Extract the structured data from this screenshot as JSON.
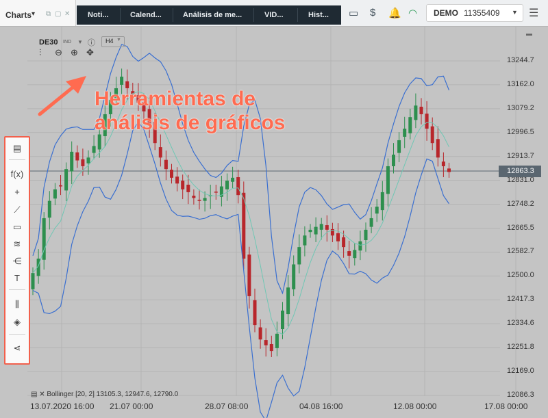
{
  "window": {
    "title": "Charts",
    "tabs": [
      "Noti...",
      "Calend...",
      "Análisis de me...",
      "VID...",
      "Hist..."
    ]
  },
  "account": {
    "mode": "DEMO",
    "number": "11355409"
  },
  "chart_header": {
    "symbol": "DE30",
    "instrument_tag": "IND",
    "timeframe": "H4"
  },
  "annotation": {
    "line1": "Herramientas de",
    "line2": "análisis de gráficos",
    "color": "#ff6b50"
  },
  "toolbar_icons": [
    "chart-type-icon",
    "function-icon",
    "crosshair-icon",
    "trend-line-icon",
    "rectangle-icon",
    "fibonacci-icon",
    "pitchfork-icon",
    "text-icon",
    "indicators-icon",
    "layers-icon",
    "share-icon"
  ],
  "legend": {
    "text": "Bollinger [20, 2] 13105.3, 12947.6, 12790.0"
  },
  "chart_data": {
    "type": "candlestick",
    "y_ticks": [
      "13244.7",
      "13162.0",
      "13079.2",
      "12996.5",
      "12913.7",
      "12831.0",
      "12748.2",
      "12665.5",
      "12582.7",
      "12500.0",
      "12417.3",
      "12334.6",
      "12251.8",
      "12169.0",
      "12086.3"
    ],
    "x_ticks": [
      "13.07.2020 16:00",
      "21.07 00:00",
      "28.07 08:00",
      "04.08 16:00",
      "12.08 00:00",
      "17.08 00:00"
    ],
    "last_price": "12863.3",
    "ylim": [
      12086.3,
      13244.7
    ],
    "series": [
      {
        "name": "Bollinger upper",
        "color": "#3a6fd0"
      },
      {
        "name": "Bollinger middle",
        "color": "#6fc7b4"
      },
      {
        "name": "Bollinger lower",
        "color": "#3a6fd0"
      }
    ],
    "colors": {
      "up": "#2d8f4e",
      "down": "#b8262b"
    },
    "candles": [
      12510,
      12560,
      12700,
      12760,
      12800,
      12810,
      12870,
      12930,
      12900,
      12880,
      12910,
      12950,
      12990,
      13060,
      13110,
      13150,
      13190,
      13150,
      13130,
      13100,
      13070,
      13020,
      12960,
      12910,
      12870,
      12840,
      12820,
      12800,
      12790,
      12770,
      12760,
      12770,
      12780,
      12790,
      12810,
      12830,
      12840,
      12780,
      12560,
      12430,
      12330,
      12280,
      12260,
      12240,
      12300,
      12380,
      12460,
      12540,
      12600,
      12640,
      12660,
      12670,
      12680,
      12660,
      12640,
      12620,
      12600,
      12570,
      12590,
      12620,
      12660,
      12700,
      12740,
      12790,
      12880,
      12920,
      12970,
      13010,
      13050,
      13090,
      13060,
      13010,
      12960,
      12910,
      12880,
      12860
    ]
  }
}
